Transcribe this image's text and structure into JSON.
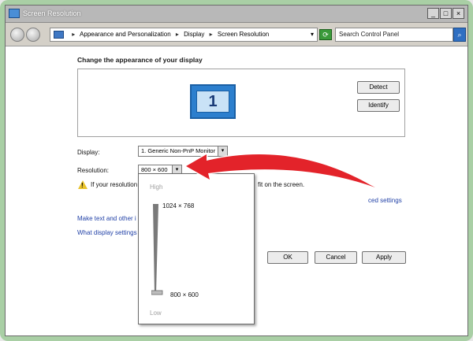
{
  "window": {
    "title": "Screen Resolution",
    "controls": [
      "_",
      "□",
      "×"
    ]
  },
  "navigation": {
    "breadcrumb": [
      "Appearance and Personalization",
      "Display",
      "Screen Resolution"
    ],
    "search_placeholder": "Search Control Panel"
  },
  "main": {
    "heading": "Change the appearance of your display",
    "monitor_number": "1",
    "detect_label": "Detect",
    "identify_label": "Identify",
    "display_label": "Display:",
    "display_value": "1. Generic Non-PnP Monitor",
    "resolution_label": "Resolution:",
    "resolution_value": "800 × 600",
    "warning_text_start": "If your resolution",
    "warning_text_end": "fit on the screen.",
    "advanced_link": "ced settings",
    "link_text_size": "Make text and other i",
    "link_display_settings": "What display settings",
    "ok_label": "OK",
    "cancel_label": "Cancel",
    "apply_label": "Apply"
  },
  "resolution_popup": {
    "high_label": "High",
    "top_value": "1024 × 768",
    "bottom_value": "800 × 600",
    "low_label": "Low",
    "slider_level": 0.0
  },
  "colors": {
    "annotation_arrow": "#e3232a",
    "frame": "#a9cfa5",
    "link": "#1f3fa6"
  }
}
